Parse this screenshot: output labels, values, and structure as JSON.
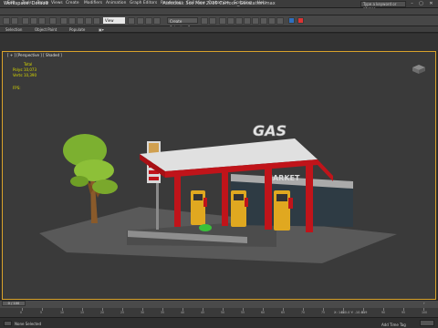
{
  "titlebar": {
    "workspace": "Workspace: Default",
    "title": "Autodesk 3ds Max 2016    Cartoon_Gasstation.max",
    "search_placeholder": "Type a keyword or phrase"
  },
  "menus": [
    "Edit",
    "Tools",
    "Group",
    "Views",
    "Create",
    "Modifiers",
    "Animation",
    "Graph Editors",
    "Rendering",
    "Civil View",
    "Customize",
    "Scripting",
    "Help"
  ],
  "toolbar": {
    "view_dropdown": "View",
    "selection_dropdown": "Create Selection Se"
  },
  "ribbon_tabs": [
    "Selection",
    "Object Paint",
    "Populate"
  ],
  "viewport": {
    "label": "[ + ] [Perspective ] [ Shaded ]",
    "stats_header": "Total",
    "polys_label": "Polys:",
    "polys_value": "10,073",
    "verts_label": "Verts:",
    "verts_value": "10,390",
    "fps_label": "FPS:",
    "sign_gas": "GAS",
    "sign_market": "MARKET"
  },
  "timeline": {
    "frame": "0 / 100",
    "ticks": [
      "0",
      "5",
      "10",
      "15",
      "20",
      "25",
      "30",
      "35",
      "40",
      "45",
      "50",
      "55",
      "60",
      "65",
      "70",
      "75",
      "80",
      "85",
      "90",
      "95",
      "100"
    ]
  },
  "status": {
    "text": "None Selected",
    "add_time_tag": "Add Time Tag",
    "coords": "X: 1410.0  Y: -10.019"
  },
  "colors": {
    "viewport_bg": "#3a3a3a",
    "viewport_border": "#d9a22b",
    "stat_text": "#d8d800",
    "canopy_red": "#c0141a"
  }
}
